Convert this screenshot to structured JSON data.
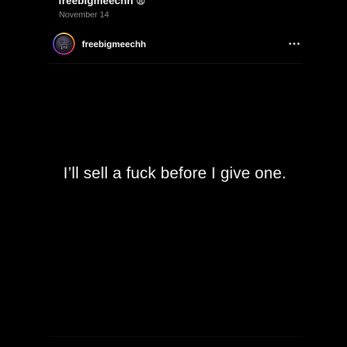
{
  "previous_post": {
    "username": "freebigmeechh",
    "emoji": "😩",
    "date": "November 14"
  },
  "post": {
    "username": "freebigmeechh",
    "text": "I’ll sell a fuck before I give one.",
    "avatar_icon": "profile-photo",
    "more_icon": "more-horizontal-icon"
  },
  "colors": {
    "background": "#000000",
    "text": "#f2f2f2",
    "muted": "#8e8e8e"
  }
}
